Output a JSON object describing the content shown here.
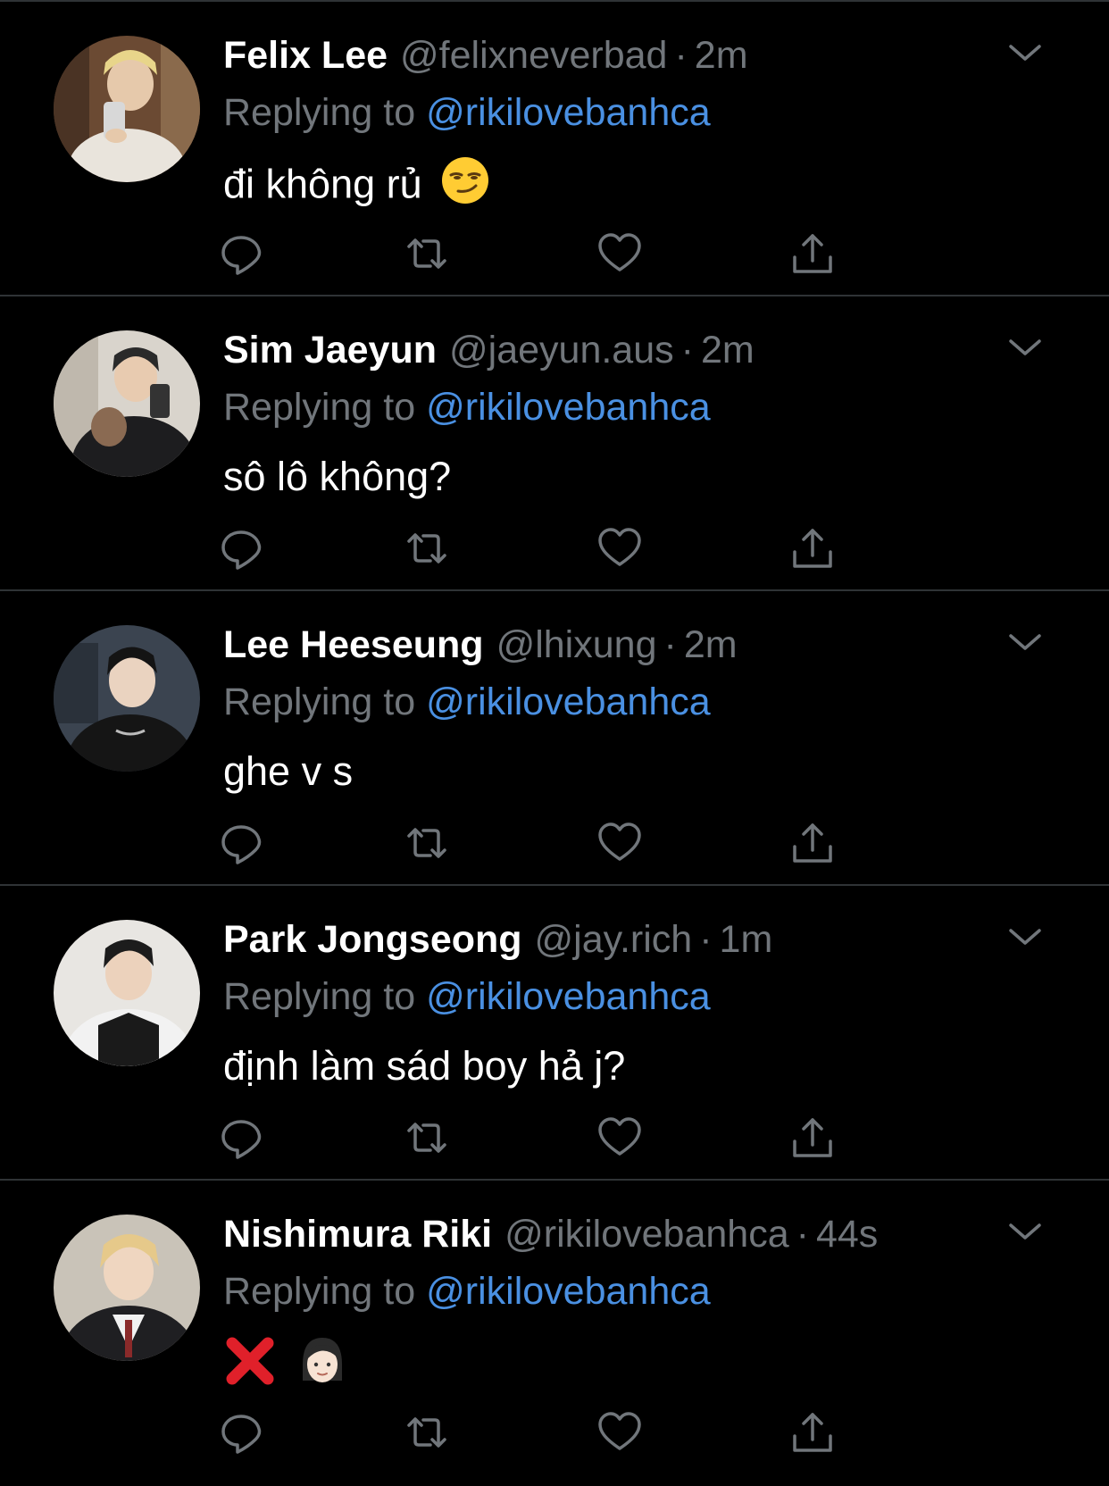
{
  "colors": {
    "background": "#000000",
    "divider": "#2f3336",
    "primary_text": "#ffffff",
    "secondary_text": "#71767b",
    "link": "#4a90e2"
  },
  "reply_label": "Replying to",
  "tweets": [
    {
      "name": "Felix Lee",
      "handle": "@felixneverbad",
      "separator": "·",
      "time": "2m",
      "replying_to": "@rikilovebanhca",
      "text": "đi không rủ",
      "emoji": [
        "smirking-face-emoji"
      ]
    },
    {
      "name": "Sim Jaeyun",
      "handle": "@jaeyun.aus",
      "separator": "·",
      "time": "2m",
      "replying_to": "@rikilovebanhca",
      "text": "sô lô không?",
      "emoji": []
    },
    {
      "name": "Lee Heeseung",
      "handle": "@lhixung",
      "separator": "·",
      "time": "2m",
      "replying_to": "@rikilovebanhca",
      "text": "ghe v s",
      "emoji": []
    },
    {
      "name": "Park Jongseong",
      "handle": "@jay.rich",
      "separator": "·",
      "time": "1m",
      "replying_to": "@rikilovebanhca",
      "text": "định làm sád boy hả j?",
      "emoji": []
    },
    {
      "name": "Nishimura Riki",
      "handle": "@rikilovebanhca",
      "separator": "·",
      "time": "44s",
      "replying_to": "@rikilovebanhca",
      "text": "",
      "emoji": [
        "cross-mark-emoji",
        "woman-face-emoji"
      ]
    }
  ],
  "action_icons": [
    "reply-icon",
    "retweet-icon",
    "like-icon",
    "share-icon"
  ]
}
